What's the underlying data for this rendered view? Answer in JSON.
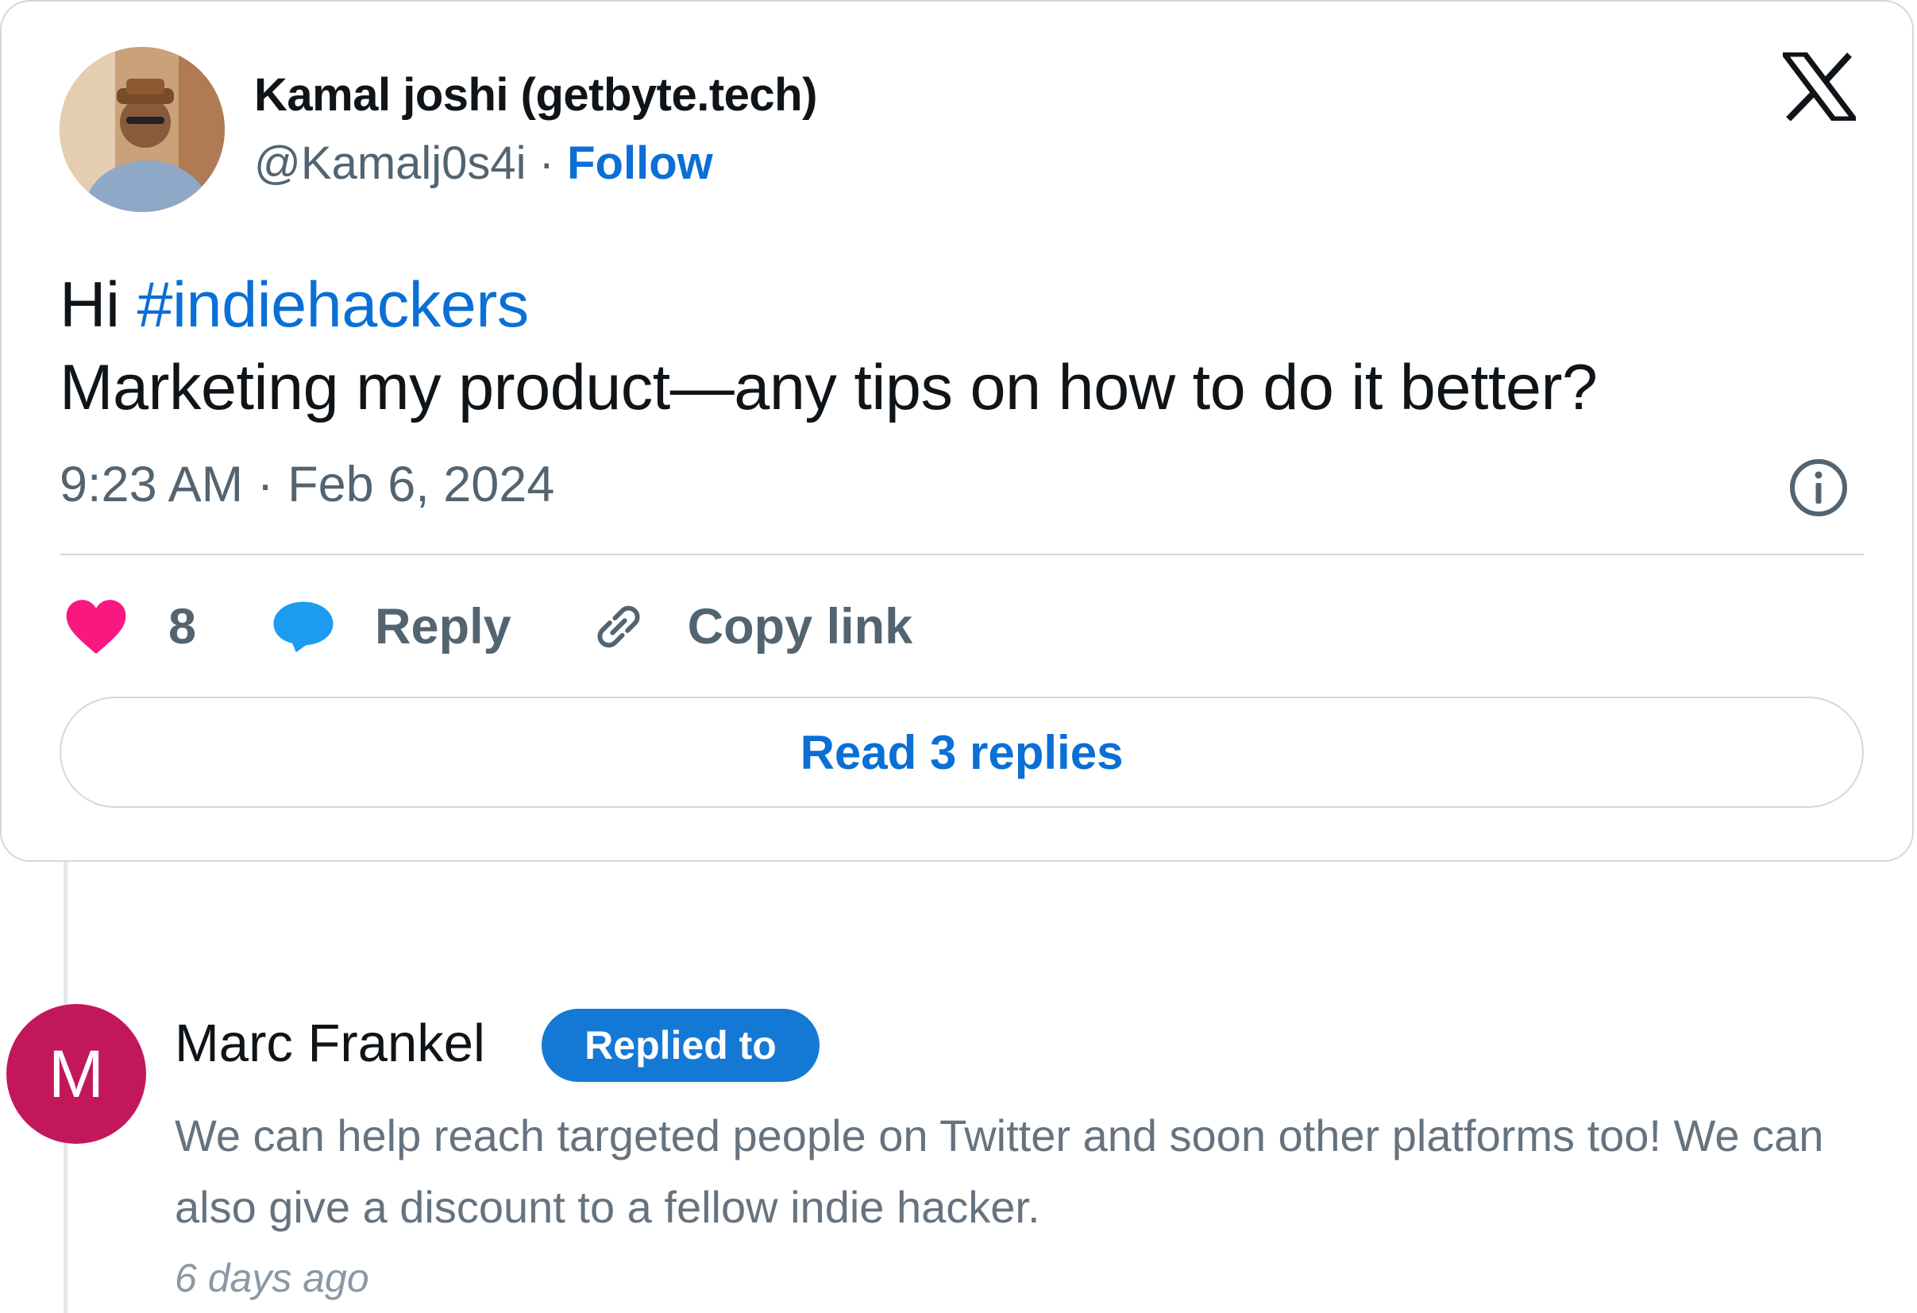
{
  "tweet": {
    "author_name": "Kamal joshi (getbyte.tech)",
    "handle": "@Kamalj0s4i",
    "separator": " · ",
    "follow_label": "Follow",
    "text_prefix": "Hi ",
    "hashtag": "#indiehackers",
    "text_body": "Marketing my product—any tips on how to do it better?",
    "timestamp": "9:23 AM · Feb 6, 2024",
    "like_count": "8",
    "reply_label": "Reply",
    "copy_link_label": "Copy link",
    "read_replies_label": "Read 3 replies"
  },
  "reply": {
    "avatar_letter": "M",
    "name": "Marc Frankel",
    "badge": "Replied to",
    "text": "We can help reach targeted people on Twitter and soon other platforms too! We can also give a discount to a fellow indie hacker.",
    "time": "6 days ago"
  },
  "colors": {
    "link_blue": "#0a6fd6",
    "like_pink": "#f91880",
    "reply_blue": "#1d9bf0",
    "avatar_magenta": "#c2185b"
  },
  "icons": {
    "brand": "x-logo-icon",
    "info": "info-icon",
    "like": "heart-icon",
    "reply": "speech-bubble-icon",
    "copy": "link-icon"
  }
}
